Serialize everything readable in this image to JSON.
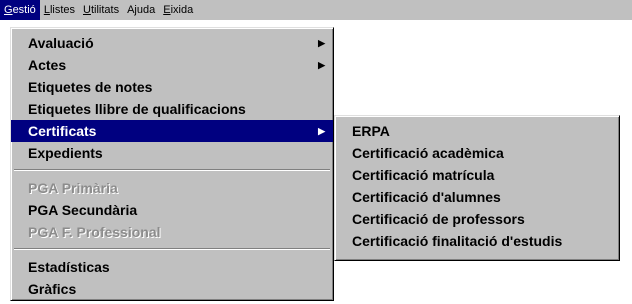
{
  "menubar": {
    "items": [
      {
        "first": "G",
        "rest": "estió"
      },
      {
        "first": "L",
        "rest": "listes"
      },
      {
        "first": "U",
        "rest": "tilitats"
      },
      {
        "first": "",
        "rest": "Ajuda"
      },
      {
        "first": "E",
        "rest": "ixida"
      }
    ]
  },
  "gestio_menu": {
    "group1": [
      {
        "label": "Avaluació",
        "submenu": true
      },
      {
        "label": "Actes",
        "submenu": true
      },
      {
        "label": "Etiquetes de notes",
        "submenu": false
      },
      {
        "label": "Etiquetes llibre de qualificacions",
        "submenu": false
      },
      {
        "label": "Certificats",
        "submenu": true,
        "selected": true
      },
      {
        "label": "Expedients",
        "submenu": false
      }
    ],
    "group2": [
      {
        "label": "PGA Primària",
        "enabled": false
      },
      {
        "label": "PGA Secundària",
        "enabled": true
      },
      {
        "label": "PGA F. Professional",
        "enabled": false
      }
    ],
    "group3": [
      {
        "label": "Estadísticas"
      },
      {
        "label": "Gràfics"
      }
    ]
  },
  "certificats_submenu": {
    "items": [
      {
        "label": "ERPA"
      },
      {
        "label": "Certificació acadèmica"
      },
      {
        "label": "Certificació matrícula"
      },
      {
        "label": "Certificació d'alumnes"
      },
      {
        "label": "Certificació de professors"
      },
      {
        "label": "Certificació finalitació d'estudis"
      }
    ]
  },
  "icons": {
    "submenu_arrow": "triangle-right-icon"
  },
  "colors": {
    "menu_bg": "#c0c0c0",
    "highlight": "#000080",
    "disabled_text": "#8c8c8c"
  }
}
